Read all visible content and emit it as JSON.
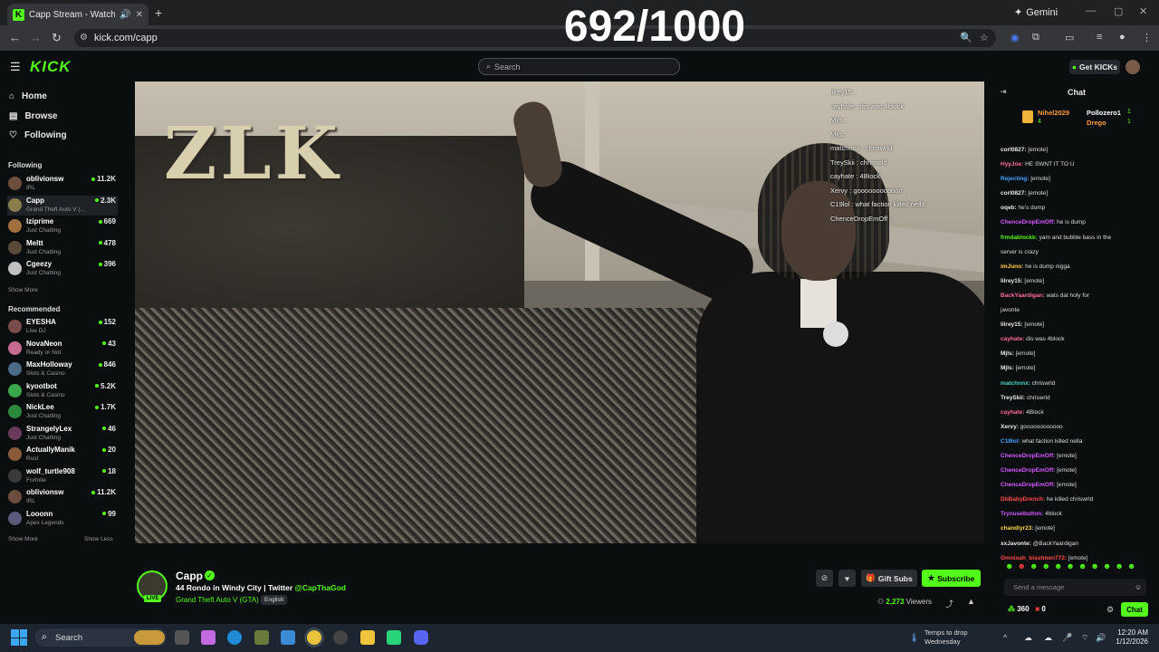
{
  "browser": {
    "tab_title": "Capp Stream - Watch Live on Kick",
    "new_tab": "+",
    "url": "kick.com/capp",
    "gemini_label": "Gemini",
    "counter": "692/1000"
  },
  "header": {
    "logo": "KICK",
    "search_placeholder": "Search",
    "get_kicks": "Get KICKs"
  },
  "sidebar": {
    "nav": [
      {
        "label": "Home",
        "icon": "home-icon"
      },
      {
        "label": "Browse",
        "icon": "browse-icon"
      },
      {
        "label": "Following",
        "icon": "heart-icon"
      }
    ],
    "following_title": "Following",
    "following": [
      {
        "name": "oblivionsw",
        "category": "IRL",
        "viewers": "11.2K",
        "color": "#6a4d3c"
      },
      {
        "name": "Capp",
        "category": "Grand Theft Auto V (...",
        "viewers": "2.3K",
        "color": "#8a7d4c"
      },
      {
        "name": "Iziprime",
        "category": "Just Chatting",
        "viewers": "669",
        "color": "#a2703f"
      },
      {
        "name": "Meltt",
        "category": "Just Chatting",
        "viewers": "478",
        "color": "#5a4a3a"
      },
      {
        "name": "Cgeezy",
        "category": "Just Chatting",
        "viewers": "396",
        "color": "#c0c0c0"
      }
    ],
    "show_more_1": "Show More",
    "recommended_title": "Recommended",
    "recommended": [
      {
        "name": "EYESHA",
        "category": "Live DJ",
        "viewers": "152",
        "color": "#7a4b4b"
      },
      {
        "name": "NovaNeon",
        "category": "Ready or Not",
        "viewers": "43",
        "color": "#c86a8f"
      },
      {
        "name": "MaxHolloway",
        "category": "Slots & Casino",
        "viewers": "846",
        "color": "#4b6a8a"
      },
      {
        "name": "kyootbot",
        "category": "Slots & Casino",
        "viewers": "5.2K",
        "color": "#3aa84a"
      },
      {
        "name": "NickLee",
        "category": "Just Chatting",
        "viewers": "1.7K",
        "color": "#2a8a3a"
      },
      {
        "name": "StrangelyLex",
        "category": "Just Chatting",
        "viewers": "46",
        "color": "#6a3a5a"
      },
      {
        "name": "ActuallyManik",
        "category": "Rust",
        "viewers": "20",
        "color": "#8a5a3a"
      },
      {
        "name": "wolf_turtle908",
        "category": "Fortnite",
        "viewers": "18",
        "color": "#3a3a3a"
      },
      {
        "name": "oblivionsw",
        "category": "IRL",
        "viewers": "11.2K",
        "color": "#6a4d3c"
      },
      {
        "name": "Looonn",
        "category": "Apex Legends",
        "viewers": "99",
        "color": "#5a5a7a"
      }
    ],
    "show_more_2": "Show More",
    "show_less": "Show Less"
  },
  "video": {
    "sign_text": "ZLK",
    "overlay_chat": [
      "lilrey15 : ",
      "cayhate : dis was 4block",
      "Mjls : ",
      "Mjls : ",
      "matchnnx : chriswrld",
      "TreySkii : chriswrld",
      "cayhate : 4Block",
      "Xervy : goooooooooooo",
      "C19lol : what faction killed nella",
      "ChenceDropEmOff : "
    ]
  },
  "stream": {
    "name": "Capp",
    "live": "LIVE",
    "title": "44 Rondo in Windy City | Twitter ",
    "twitter": "@CapThaGod",
    "category": "Grand Theft Auto V (GTA)",
    "language": "English",
    "gift_subs": "Gift Subs",
    "subscribe": "Subscribe",
    "viewer_count": "2,273",
    "viewer_label": "Viewers"
  },
  "chat": {
    "title": "Chat",
    "gifters": [
      {
        "name": "Nihel2029",
        "amount": "4"
      },
      {
        "name": "Pollozero1",
        "amount": "1"
      },
      {
        "name": "Drego",
        "amount": "1"
      }
    ],
    "messages": [
      {
        "user": "corl0827:",
        "text": " [emote]",
        "color": "#e8e8e8"
      },
      {
        "user": "HyyJoe:",
        "text": " HE SWNT IT TO U",
        "color": "#ff6b9a"
      },
      {
        "user": "Rejecting:",
        "text": " [emote]",
        "color": "#4aa3ff"
      },
      {
        "user": "corl0827:",
        "text": " [emote]",
        "color": "#e8e8e8"
      },
      {
        "user": "oqeb:",
        "text": " he's dump",
        "color": "#e8e8e8"
      },
      {
        "user": "ChenceDropEmOff:",
        "text": " he is dump",
        "color": "#d45aff"
      },
      {
        "user": "frmdablockk:",
        "text": " yam and bubble bass in the",
        "color": "#53fc18"
      },
      {
        "user": "",
        "text": "server is crazy",
        "color": "#e8e8e8"
      },
      {
        "user": "imJuno:",
        "text": " he is dump nigga",
        "color": "#ffd24a"
      },
      {
        "user": "lilrey15:",
        "text": " [emote]",
        "color": "#e8e8e8"
      },
      {
        "user": "BackYaardigan:",
        "text": " wats dat holy for",
        "color": "#ff6b9a"
      },
      {
        "user": "",
        "text": "javonte",
        "color": "#e8e8e8"
      },
      {
        "user": "lilrey15:",
        "text": " [emote]",
        "color": "#e8e8e8"
      },
      {
        "user": "cayhate:",
        "text": " dis was 4block",
        "color": "#ff6b9a"
      },
      {
        "user": "Mjls:",
        "text": " [emote]",
        "color": "#e8e8e8"
      },
      {
        "user": "Mjls:",
        "text": " [emote]",
        "color": "#e8e8e8"
      },
      {
        "user": "matchnnx:",
        "text": " chriswrld",
        "color": "#4ad4c4"
      },
      {
        "user": "TreySkii:",
        "text": " chriswrld",
        "color": "#e8e8e8"
      },
      {
        "user": "cayhate:",
        "text": " 4Block",
        "color": "#ff6b9a"
      },
      {
        "user": "Xervy:",
        "text": " goooooooooooo",
        "color": "#e8e8e8"
      },
      {
        "user": "C19lol:",
        "text": " what faction killed nella",
        "color": "#4aa3ff"
      },
      {
        "user": "ChenceDropEmOff:",
        "text": " [emote]",
        "color": "#d45aff"
      },
      {
        "user": "ChenceDropEmOff:",
        "text": " [emote]",
        "color": "#d45aff"
      },
      {
        "user": "ChenceDropEmOff:",
        "text": " [emote]",
        "color": "#d45aff"
      },
      {
        "user": "DbBabyDrench:",
        "text": " he killed chriswrld",
        "color": "#ff4a4a"
      },
      {
        "user": "Trynusebutton:",
        "text": " 4block",
        "color": "#d45aff"
      },
      {
        "user": "chandlyr23:",
        "text": " [emote]",
        "color": "#ffd24a"
      },
      {
        "user": "xxJavonte:",
        "text": " @BackYaardigan",
        "color": "#e8e8e8"
      },
      {
        "user": "Omnisah_blastmen772:",
        "text": " [emote]",
        "color": "#ff4a4a"
      }
    ],
    "send_placeholder": "Send a message",
    "points": "360",
    "kicks": "0",
    "chat_button": "Chat"
  },
  "taskbar": {
    "search": "Search",
    "weather_title": "Temps to drop",
    "weather_day": "Wednesday",
    "time": "12:20 AM",
    "date": "1/12/2026"
  }
}
